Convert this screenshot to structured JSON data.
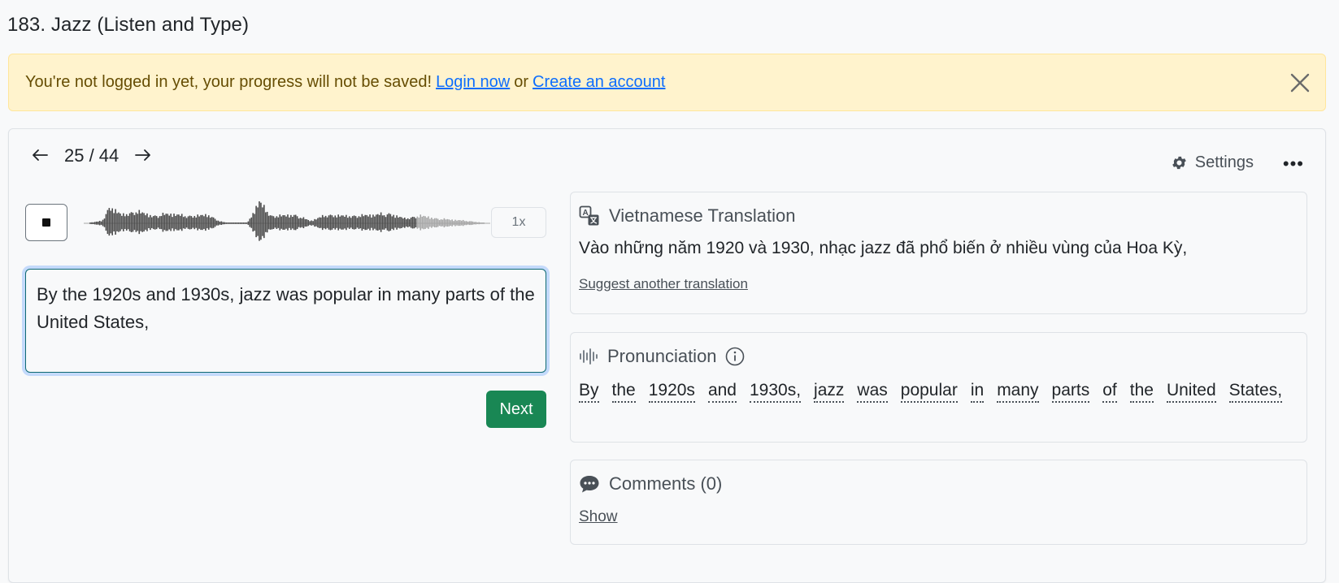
{
  "page": {
    "title": "183. Jazz (Listen and Type)"
  },
  "alert": {
    "message": "You're not logged in yet, your progress will not be saved!",
    "login_label": "Login now",
    "or_label": "or",
    "create_label": "Create an account",
    "close_icon": "close-icon"
  },
  "nav": {
    "prev_icon": "arrow-left-icon",
    "counter": "25 / 44",
    "next_icon": "arrow-right-icon"
  },
  "toolbar": {
    "settings_label": "Settings",
    "settings_icon": "gear-icon",
    "more_label": "•••"
  },
  "player": {
    "stop_icon": "stop-icon",
    "speed_label": "1x",
    "progress_fraction": 0.83,
    "played_color": "#4a4a4a",
    "unplayed_color": "#a6a6a6"
  },
  "answer": {
    "value": "By the 1920s and 1930s, jazz was popular in many parts of the United States,"
  },
  "next_button": {
    "label": "Next",
    "color": "#198754"
  },
  "translation": {
    "title": "Vietnamese Translation",
    "icon": "translate-icon",
    "text": "Vào những năm 1920 và 1930, nhạc jazz đã phổ biến ở nhiều vùng của Hoa Kỳ,",
    "suggest_label": "Suggest another translation"
  },
  "pronunciation": {
    "title": "Pronunciation",
    "icon": "audio-wave-icon",
    "info_icon": "info-icon",
    "words": [
      "By",
      "the",
      "1920s",
      "and",
      "1930s,",
      "jazz",
      "was",
      "popular",
      "in",
      "many",
      "parts",
      "of",
      "the",
      "United",
      "States,"
    ]
  },
  "comments": {
    "title": "Comments (0)",
    "icon": "comment-icon",
    "show_label": "Show"
  }
}
